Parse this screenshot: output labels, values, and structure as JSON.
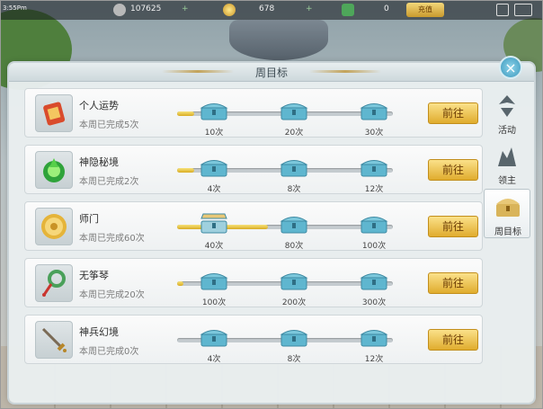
{
  "topbar": {
    "status_time": "3:55Pm",
    "resource1": "107625",
    "resource2": "678",
    "resource3": "0",
    "pay_button": "充值"
  },
  "panel": {
    "title": "周目标",
    "close": "×"
  },
  "side_tabs": [
    {
      "label": "活动",
      "icon": "activity-icon"
    },
    {
      "label": "领主",
      "icon": "lord-icon"
    },
    {
      "label": "周目标",
      "icon": "chest-icon",
      "active": true
    }
  ],
  "rows": [
    {
      "name": "个人运势",
      "progress": "本周已完成5次",
      "button": "前往",
      "icon": "fortune-scroll-icon",
      "milestones": [
        "10次",
        "20次",
        "30次"
      ],
      "fill_fraction": 0.08
    },
    {
      "name": "神隐秘境",
      "progress": "本周已完成2次",
      "button": "前往",
      "icon": "green-flame-icon",
      "milestones": [
        "4次",
        "8次",
        "12次"
      ],
      "fill_fraction": 0.08
    },
    {
      "name": "师门",
      "progress": "本周已完成60次",
      "button": "前往",
      "icon": "gold-coin-icon",
      "milestones": [
        "40次",
        "80次",
        "100次"
      ],
      "fill_fraction": 0.42,
      "opened_chest": 0
    },
    {
      "name": "无筝琴",
      "progress": "本周已完成20次",
      "button": "前往",
      "icon": "jade-pendant-icon",
      "milestones": [
        "100次",
        "200次",
        "300次"
      ],
      "fill_fraction": 0.03
    },
    {
      "name": "神兵幻境",
      "progress": "本周已完成0次",
      "button": "前往",
      "icon": "sword-icon",
      "milestones": [
        "4次",
        "8次",
        "12次"
      ],
      "fill_fraction": 0
    }
  ],
  "colors": {
    "accent_gold": "#e0ac2e",
    "chest_blue": "#5fb6cf",
    "panel_bg": "#e9eef0"
  }
}
